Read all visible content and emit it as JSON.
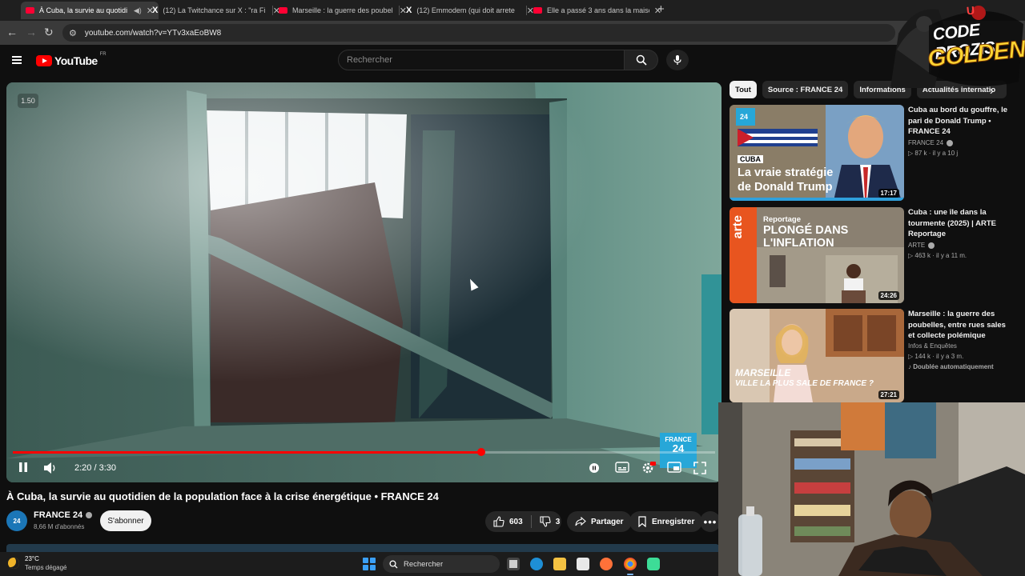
{
  "browser": {
    "tabs": [
      {
        "title": "À Cuba, la survie au quotidi",
        "favicon": "youtube-icon",
        "active": true
      },
      {
        "title": "(12) La Twitchance sur X : \"ra Fi",
        "favicon": "x-icon",
        "active": false
      },
      {
        "title": "Marseille : la guerre des poubel",
        "favicon": "youtube-icon",
        "active": false
      },
      {
        "title": "(12) Emmodem (qui doit arrete",
        "favicon": "x-icon",
        "active": false
      },
      {
        "title": "Elle a passé 3 ans dans la maiso",
        "favicon": "youtube-icon",
        "active": false
      }
    ],
    "url": "youtube.com/watch?v=YTv3xaEoBW8"
  },
  "youtube": {
    "logo_text": "YouTube",
    "country_code": "FR",
    "search_placeholder": "Rechercher"
  },
  "player": {
    "speed_label": "1.50",
    "time_display": "2:20 / 3:30",
    "progress_fraction": 0.667,
    "overlay_logo": {
      "line1": "FRANCE",
      "line2": "24"
    }
  },
  "video": {
    "title": "À Cuba, la survie au quotidien de la population face à la crise énergétique • FRANCE 24",
    "channel": {
      "name": "FRANCE 24",
      "avatar_text": "24",
      "subscribers": "8,66 M d'abonnés"
    },
    "subscribe_label": "S'abonner",
    "likes": "603",
    "dislikes": "3",
    "share_label": "Partager",
    "save_label": "Enregistrer"
  },
  "chips": [
    "Tout",
    "Source : FRANCE 24",
    "Informations",
    "Actualités internatio"
  ],
  "recommendations": [
    {
      "title": "Cuba au bord du gouffre, le pari de Donald Trump • FRANCE 24",
      "channel": "FRANCE 24",
      "verified": true,
      "meta": "87 k · il y a 10 j",
      "duration": "17:17",
      "thumb_text": {
        "tag": "CUBA",
        "line1": "La vraie stratégie",
        "line2": "de Donald Trump",
        "logo": "24"
      }
    },
    {
      "title": "Cuba : une île dans la tourmente (2025) | ARTE Reportage",
      "channel": "ARTE",
      "verified": true,
      "meta": "463 k · il y a 11 m.",
      "duration": "24:26",
      "thumb_text": {
        "tag": "Reportage",
        "line1": "PLONGÉ DANS",
        "line2": "L'INFLATION",
        "logo": "arte"
      }
    },
    {
      "title": "Marseille : la guerre des poubelles, entre rues sales et collecte polémique",
      "channel": "Infos & Enquêtes",
      "verified": false,
      "meta": "144 k · il y a 3 m.",
      "badge": "Doublée automatiquement",
      "duration": "27:21",
      "thumb_text": {
        "line1": "MARSEILLE",
        "line2": "VILLE LA PLUS SALE DE FRANCE ?"
      }
    }
  ],
  "overlay": {
    "logo_line1": "CODE PROZIS",
    "logo_line2": "GOLDENG",
    "logo_letter": "U"
  },
  "taskbar": {
    "temperature": "23°C",
    "weather": "Temps dégagé",
    "search_label": "Rechercher"
  },
  "colors": {
    "accent": "#ff0000",
    "france24": "#27a7d8",
    "arte": "#e8551f"
  }
}
